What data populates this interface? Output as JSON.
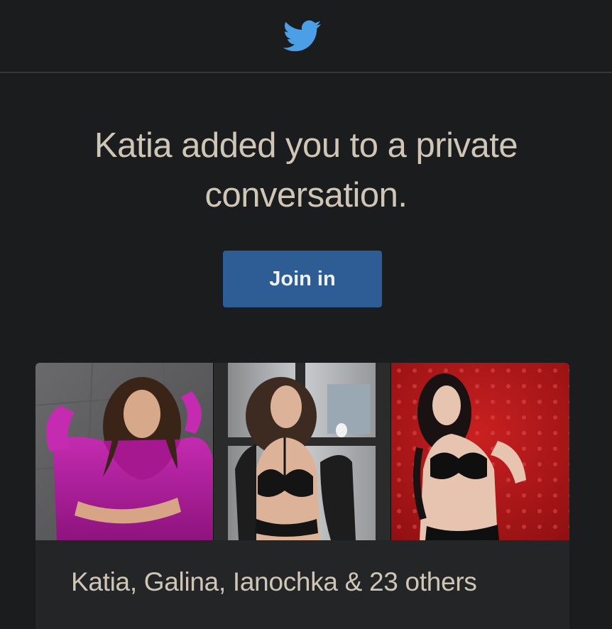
{
  "header": {
    "logo_icon": "twitter-bird-icon",
    "logo_color": "#4a9fe6"
  },
  "main": {
    "headline": "Katia added you to a private conversation.",
    "join_button_label": "Join in",
    "join_button_color": "#2e5d96"
  },
  "conversation_card": {
    "photos": [
      {
        "icon": "profile-photo-1",
        "dominant_color": "#b0209a"
      },
      {
        "icon": "profile-photo-2",
        "dominant_color": "#3a3b3c"
      },
      {
        "icon": "profile-photo-3",
        "dominant_color": "#b51a1a"
      }
    ],
    "participants": "Katia, Galina, Ianochka & 23 others"
  }
}
